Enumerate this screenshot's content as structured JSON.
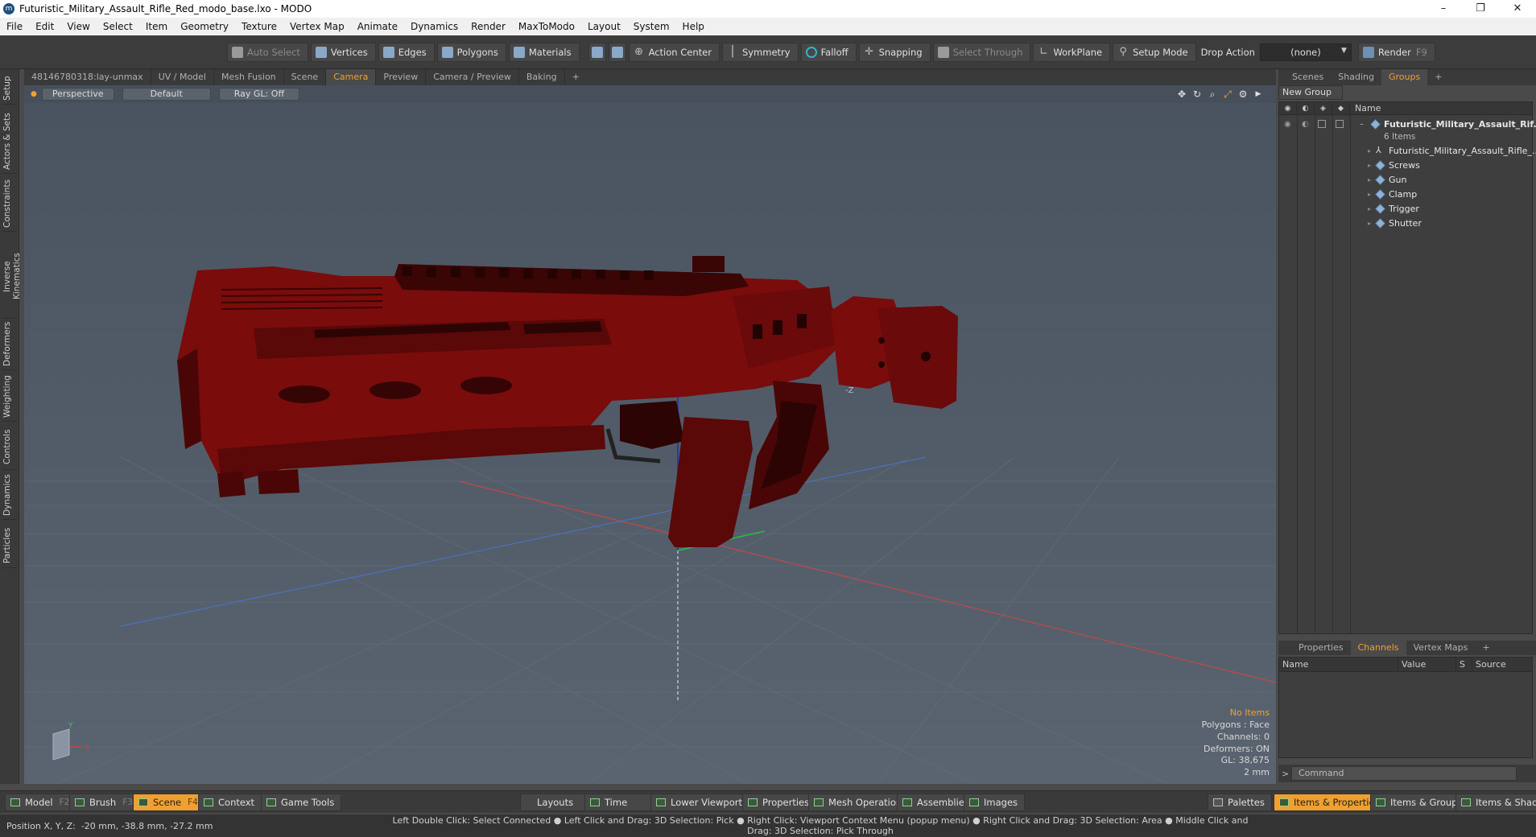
{
  "window": {
    "title": "Futuristic_Military_Assault_Rifle_Red_modo_base.lxo - MODO",
    "minimize": "–",
    "maximize": "❐",
    "close": "✕"
  },
  "menu": [
    "File",
    "Edit",
    "View",
    "Select",
    "Item",
    "Geometry",
    "Texture",
    "Vertex Map",
    "Animate",
    "Dynamics",
    "Render",
    "MaxToModo",
    "Layout",
    "System",
    "Help"
  ],
  "toolbar": {
    "auto_select": "Auto Select",
    "vertices": "Vertices",
    "edges": "Edges",
    "polygons": "Polygons",
    "materials": "Materials",
    "action_center": "Action Center",
    "symmetry": "Symmetry",
    "falloff": "Falloff",
    "snapping": "Snapping",
    "select_through": "Select Through",
    "workplane": "WorkPlane",
    "setup_mode": "Setup Mode",
    "drop_action_label": "Drop Action",
    "drop_action_value": "(none)",
    "render": "Render",
    "render_key": "F9"
  },
  "left_tabs": [
    "Setup",
    "Actors & Sets",
    "Constraints",
    "Inverse Kinematics",
    "Deformers",
    "Weighting",
    "Controls",
    "Dynamics",
    "Particles"
  ],
  "viewport_tabs": [
    "48146780318:lay-unmax",
    "UV / Model",
    "Mesh Fusion",
    "Scene",
    "Camera",
    "Preview",
    "Camera / Preview",
    "Baking",
    "+"
  ],
  "viewport_active_tab": "Camera",
  "viewport_header": {
    "view": "Perspective",
    "shading": "Default",
    "raygl": "Ray GL: Off"
  },
  "viewport_info": {
    "items": "No Items",
    "polygons": "Polygons : Face",
    "channels": "Channels: 0",
    "deformers": "Deformers: ON",
    "gl": "GL: 38,675",
    "grid": "2 mm"
  },
  "axis_labels": {
    "neg_z": "-Z",
    "y": "Y",
    "x": "X"
  },
  "right_tabs": [
    "Scenes",
    "Shading",
    "Groups",
    "+"
  ],
  "right_active_tab": "Groups",
  "new_group": "New Group",
  "groups_header": {
    "name": "Name"
  },
  "groups": {
    "root": "Futuristic_Military_Assault_Rif...",
    "root_count": "6 Items",
    "children": [
      "Futuristic_Military_Assault_Rifle_...",
      "Screws",
      "Gun",
      "Clamp",
      "Trigger",
      "Shutter"
    ]
  },
  "bottom_tabs": [
    "Properties",
    "Channels",
    "Vertex Maps",
    "+"
  ],
  "bottom_active_tab": "Channels",
  "channels_header": {
    "name": "Name",
    "value": "Value",
    "s": "S",
    "source": "Source"
  },
  "command_placeholder": "Command",
  "bottom_bar": {
    "model": "Model",
    "model_key": "F2",
    "brush": "Brush",
    "brush_key": "F3",
    "scene": "Scene",
    "scene_key": "F4",
    "context": "Context",
    "game_tools": "Game Tools",
    "layouts": "Layouts",
    "time": "Time",
    "lower_viewports": "Lower Viewports",
    "properties": "Properties",
    "mesh_operations": "Mesh Operations",
    "assemblies": "Assemblies",
    "images": "Images",
    "palettes": "Palettes",
    "items_properties": "Items & Properties",
    "items_groups": "Items & Groups",
    "items_shading": "Items & Shading"
  },
  "status": {
    "position_label": "Position X, Y, Z:",
    "position_value": "-20 mm, -38.8 mm, -27.2 mm",
    "hint": "Left Double Click: Select Connected ● Left Click and Drag: 3D Selection: Pick ● Right Click: Viewport Context Menu (popup menu) ● Right Click and Drag: 3D Selection: Area ● Middle Click and Drag: 3D Selection: Pick Through"
  },
  "colors": {
    "accent": "#f0a030",
    "model": "#7a0c0c"
  }
}
